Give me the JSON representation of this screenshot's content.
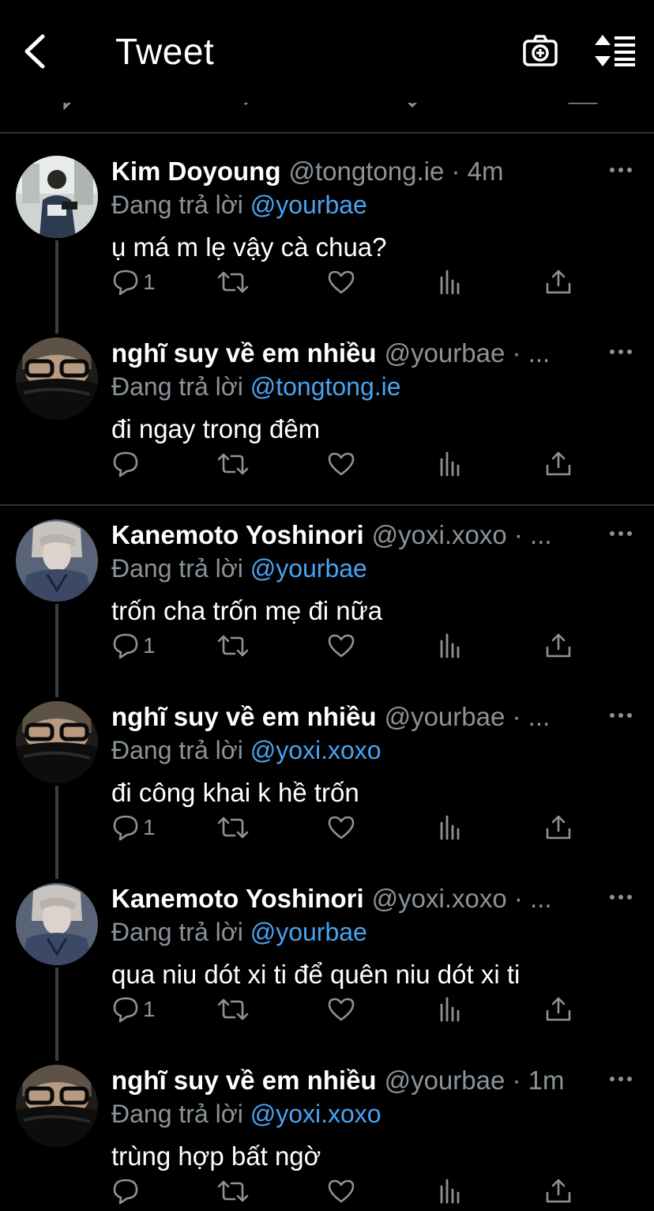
{
  "header": {
    "title": "Tweet"
  },
  "tweets": [
    {
      "name": "Kim Doyoung",
      "handle": "@tongtong.ie · 4m",
      "reply_prefix": "Đang trả lời",
      "reply_to": "@yourbae",
      "text": "ụ má m lẹ vậy cà chua?",
      "reply_count": "1",
      "avatar": "avatar-kim"
    },
    {
      "name": "nghĩ suy về em nhiều",
      "handle": "@yourbae · ...",
      "reply_prefix": "Đang trả lời",
      "reply_to": "@tongtong.ie",
      "text": "đi ngay trong đêm",
      "reply_count": "",
      "avatar": "avatar-yourbae"
    },
    {
      "name": "Kanemoto Yoshinori",
      "handle": "@yoxi.xoxo · ...",
      "reply_prefix": "Đang trả lời",
      "reply_to": "@yourbae",
      "text": "trốn cha trốn mẹ đi nữa",
      "reply_count": "1",
      "avatar": "avatar-yoshi"
    },
    {
      "name": "nghĩ suy về em nhiều",
      "handle": "@yourbae · ...",
      "reply_prefix": "Đang trả lời",
      "reply_to": "@yoxi.xoxo",
      "text": "đi công khai k hề trốn",
      "reply_count": "1",
      "avatar": "avatar-yourbae"
    },
    {
      "name": "Kanemoto Yoshinori",
      "handle": "@yoxi.xoxo · ...",
      "reply_prefix": "Đang trả lời",
      "reply_to": "@yourbae",
      "text": "qua niu dót xi ti để quên niu dót xi ti",
      "reply_count": "1",
      "avatar": "avatar-yoshi"
    },
    {
      "name": "nghĩ suy về em nhiều",
      "handle": "@yourbae · 1m",
      "reply_prefix": "Đang trả lời",
      "reply_to": "@yoxi.xoxo",
      "text": "trùng hợp bất ngờ",
      "reply_count": "",
      "avatar": "avatar-yourbae"
    }
  ],
  "colors": {
    "mention": "#4aa3f0",
    "muted": "#8b9399",
    "background": "#000000"
  }
}
